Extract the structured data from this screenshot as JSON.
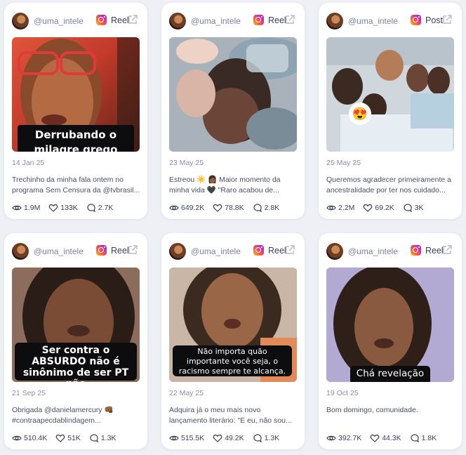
{
  "cards": [
    {
      "handle": "@uma_intele...",
      "platform_icon": "instagram-icon",
      "post_type": "Reel",
      "thumb_text": "Derrubando o milagre grego",
      "date": "14 Jan 25",
      "caption": "Trechinho da minha fala ontem no programa Sem Censura da @tvbrasil...",
      "views": "1.9M",
      "likes": "133K",
      "comments": "2.7K"
    },
    {
      "handle": "@uma_intele...",
      "platform_icon": "instagram-icon",
      "post_type": "Reel",
      "thumb_text": "",
      "date": "23 May 25",
      "caption": "Estreou ☀️ 👩🏾 Maior momento da minha vida 🖤 \"Raro acabou de...",
      "views": "649.2K",
      "likes": "78.8K",
      "comments": "2.8K"
    },
    {
      "handle": "@uma_intele...",
      "platform_icon": "instagram-icon",
      "post_type": "Post",
      "thumb_text": "😍",
      "date": "25 May 25",
      "caption": "Queremos agradecer primeiramente a ancestralidade por ter nos cuidado...",
      "views": "2.2M",
      "likes": "69.2K",
      "comments": "3K"
    },
    {
      "handle": "@uma_intele...",
      "platform_icon": "instagram-icon",
      "post_type": "Reel",
      "thumb_text": "Ser contra o ABSURDO não é sinônimo de ser PT não",
      "date": "21 Sep 25",
      "caption": "Obrigada @danielamercury 👊🏾 #contraapecdablindagem...",
      "views": "510.4K",
      "likes": "51K",
      "comments": "1.3K"
    },
    {
      "handle": "@uma_intele...",
      "platform_icon": "instagram-icon",
      "post_type": "Reel",
      "thumb_text": "Não importa quão importante você seja, o racismo sempre te alcança.",
      "date": "22 May 25",
      "caption": "Adquira já o meu mais novo lançamento literário: \"E eu, não sou...",
      "views": "515.5K",
      "likes": "49.2K",
      "comments": "1.3K"
    },
    {
      "handle": "@uma_intele...",
      "platform_icon": "instagram-icon",
      "post_type": "Reel",
      "thumb_text": "Chá revelação",
      "date": "19 Oct 25",
      "caption": "Bom domingo, comunidade.",
      "views": "392.7K",
      "likes": "44.3K",
      "comments": "1.8K"
    }
  ],
  "colors": {
    "background": "#eef0f6",
    "card": "#ffffff",
    "text": "#3a3f55",
    "muted": "#8a8fa3"
  }
}
